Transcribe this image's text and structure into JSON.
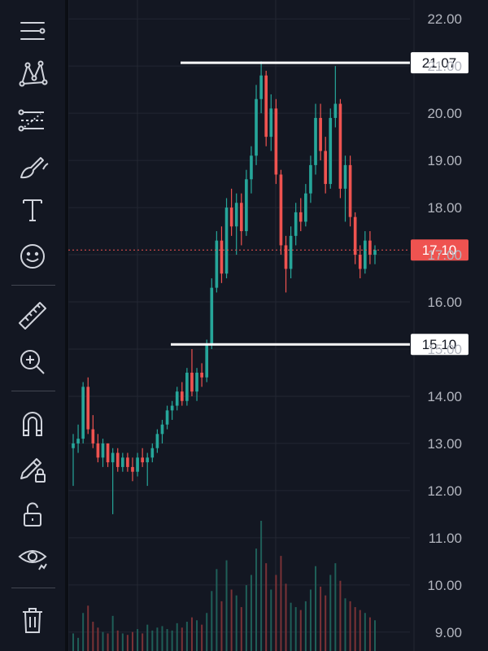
{
  "toolbar": {
    "groups": [
      [
        "crosshair-lines-icon",
        "pattern-tool-icon",
        "fib-tool-icon",
        "brush-icon",
        "text-tool-icon",
        "emoji-icon"
      ],
      [
        "ruler-icon",
        "zoom-in-icon"
      ],
      [
        "magnet-icon",
        "lock-drawing-icon",
        "unlock-icon",
        "eye-icon"
      ],
      [
        "trash-icon"
      ]
    ]
  },
  "colors": {
    "background": "#131722",
    "grid": "#232733",
    "up": "#26a69a",
    "down": "#ef5350",
    "axis_text": "#b2b5be",
    "line": "#ffffff",
    "price_line": "#ef5350"
  },
  "chart_data": {
    "type": "candlestick",
    "y_axis": {
      "min": 8.6,
      "max": 22.4,
      "ticks": [
        "22.00",
        "21.00",
        "20.00",
        "19.00",
        "18.00",
        "17.00",
        "16.00",
        "15.00",
        "14.00",
        "13.00",
        "12.00",
        "11.00",
        "10.00",
        "9.00"
      ]
    },
    "horizontal_lines": [
      {
        "value": 21.07,
        "label": "21.07"
      },
      {
        "value": 15.1,
        "label": "15.10"
      }
    ],
    "last_price": {
      "value": 17.1,
      "label": "17.10"
    },
    "candles": [
      [
        12.9,
        13.2,
        12.1,
        13.0
      ],
      [
        13.0,
        13.4,
        12.8,
        13.1
      ],
      [
        13.1,
        14.3,
        13.0,
        14.2
      ],
      [
        14.2,
        14.4,
        13.2,
        13.3
      ],
      [
        13.3,
        13.6,
        12.9,
        13.0
      ],
      [
        13.0,
        13.2,
        12.6,
        12.7
      ],
      [
        12.7,
        13.1,
        12.5,
        13.0
      ],
      [
        13.0,
        13.0,
        12.5,
        12.6
      ],
      [
        12.6,
        12.9,
        11.5,
        12.8
      ],
      [
        12.8,
        12.9,
        12.4,
        12.5
      ],
      [
        12.5,
        12.8,
        12.4,
        12.7
      ],
      [
        12.7,
        12.8,
        12.4,
        12.5
      ],
      [
        12.5,
        12.7,
        12.2,
        12.4
      ],
      [
        12.4,
        12.8,
        12.3,
        12.7
      ],
      [
        12.7,
        12.9,
        12.5,
        12.6
      ],
      [
        12.6,
        12.8,
        12.1,
        12.7
      ],
      [
        12.7,
        13.0,
        12.6,
        12.9
      ],
      [
        12.9,
        13.3,
        12.8,
        13.2
      ],
      [
        13.2,
        13.5,
        13.0,
        13.4
      ],
      [
        13.4,
        13.8,
        13.3,
        13.7
      ],
      [
        13.7,
        13.9,
        13.5,
        13.8
      ],
      [
        13.8,
        14.2,
        13.7,
        14.1
      ],
      [
        14.1,
        14.3,
        13.8,
        13.9
      ],
      [
        13.9,
        14.6,
        13.8,
        14.5
      ],
      [
        14.5,
        15.0,
        14.0,
        14.1
      ],
      [
        14.1,
        14.6,
        13.9,
        14.5
      ],
      [
        14.5,
        14.7,
        14.2,
        14.4
      ],
      [
        14.4,
        15.2,
        14.3,
        15.1
      ],
      [
        15.1,
        16.5,
        15.0,
        16.3
      ],
      [
        16.3,
        17.5,
        16.2,
        17.3
      ],
      [
        17.3,
        17.6,
        16.4,
        16.6
      ],
      [
        16.6,
        18.2,
        16.5,
        18.0
      ],
      [
        18.0,
        18.4,
        17.4,
        17.6
      ],
      [
        17.6,
        18.3,
        17.0,
        18.1
      ],
      [
        18.1,
        18.3,
        17.2,
        17.5
      ],
      [
        17.5,
        18.8,
        17.4,
        18.6
      ],
      [
        18.6,
        19.3,
        18.3,
        19.1
      ],
      [
        19.1,
        20.6,
        18.9,
        20.3
      ],
      [
        20.3,
        21.1,
        20.0,
        20.8
      ],
      [
        20.8,
        20.9,
        19.3,
        19.5
      ],
      [
        19.5,
        20.4,
        19.2,
        20.1
      ],
      [
        20.1,
        20.3,
        18.5,
        18.7
      ],
      [
        18.7,
        18.8,
        17.0,
        17.2
      ],
      [
        17.2,
        17.4,
        16.2,
        16.7
      ],
      [
        16.7,
        17.6,
        16.5,
        17.4
      ],
      [
        17.4,
        18.1,
        17.2,
        17.9
      ],
      [
        17.9,
        18.2,
        17.5,
        17.7
      ],
      [
        17.7,
        18.5,
        17.6,
        18.3
      ],
      [
        18.3,
        19.1,
        18.1,
        18.9
      ],
      [
        18.9,
        20.2,
        18.7,
        19.9
      ],
      [
        19.9,
        20.2,
        19.0,
        19.2
      ],
      [
        19.2,
        19.5,
        18.3,
        18.5
      ],
      [
        18.5,
        20.1,
        18.4,
        19.9
      ],
      [
        19.9,
        21.0,
        19.7,
        20.2
      ],
      [
        20.2,
        20.3,
        18.2,
        18.4
      ],
      [
        18.4,
        19.1,
        17.7,
        18.9
      ],
      [
        18.9,
        19.1,
        17.6,
        17.8
      ],
      [
        17.8,
        17.9,
        16.8,
        17.0
      ],
      [
        17.0,
        17.2,
        16.5,
        16.7
      ],
      [
        16.7,
        17.5,
        16.6,
        17.3
      ],
      [
        17.3,
        17.5,
        16.8,
        17.0
      ],
      [
        17.0,
        17.2,
        16.8,
        17.1
      ]
    ],
    "volumes": [
      120,
      90,
      260,
      310,
      200,
      160,
      130,
      120,
      240,
      140,
      120,
      110,
      130,
      150,
      120,
      180,
      140,
      160,
      170,
      150,
      140,
      190,
      160,
      200,
      230,
      210,
      180,
      260,
      410,
      560,
      340,
      620,
      420,
      380,
      300,
      450,
      520,
      700,
      890,
      600,
      420,
      520,
      650,
      460,
      330,
      300,
      280,
      340,
      420,
      580,
      440,
      380,
      520,
      600,
      480,
      360,
      340,
      300,
      280,
      260,
      230,
      210
    ]
  }
}
